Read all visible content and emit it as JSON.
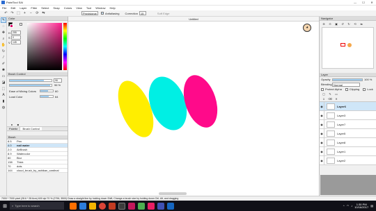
{
  "app": {
    "title": "PaintTool SAI"
  },
  "menu": [
    "File",
    "Edit",
    "Layer",
    "Filter",
    "Select",
    "Snap",
    "Colors",
    "View",
    "Tool",
    "Window",
    "Help"
  ],
  "toolbar": {
    "stabilizer_value": "Provisional",
    "antialiasing_label": "Antialiasing",
    "correction_label": "Correction",
    "correction_value": "15",
    "softedge_label": "Soft Edge"
  },
  "canvas": {
    "tab_title": "Untitled"
  },
  "color_panel": {
    "title": "Color",
    "h_value": "255",
    "s_value": "0",
    "v_value": "145"
  },
  "brush_control": {
    "title": "Brush Control",
    "size_value": "96",
    "density_value": "96 %",
    "min_size_label": "Ease of Mixing Colors",
    "min_size_value": "60",
    "load_color_label": "Load Color",
    "load_color_value": "64"
  },
  "tabs": {
    "palette": "Palette",
    "brush_control": "Brush Control"
  },
  "brush_panel": {
    "title": "Brush",
    "items": [
      {
        "size": "8.5",
        "name": "Pen"
      },
      {
        "size": "4.0",
        "name": "nail water"
      },
      {
        "size": "2.0",
        "name": "AirBrush"
      },
      {
        "size": "8.9",
        "name": "Watercolor"
      },
      {
        "size": "80",
        "name": "Blur"
      },
      {
        "size": "138",
        "name": "Thick"
      },
      {
        "size": "70",
        "name": "dots"
      },
      {
        "size": "144",
        "name": "cloud_brush_by_ashikan_cardinal"
      }
    ]
  },
  "navigator": {
    "title": "Navigator"
  },
  "layer_panel": {
    "title": "Layer",
    "opacity_label": "Opacity",
    "opacity_value": "100 %",
    "blending_label": "Blending",
    "blending_value": "Normal",
    "protect_alpha": "Protect Alpha",
    "clipping": "Clipping",
    "lock": "Lock",
    "layers": [
      "Layer6",
      "Layer3",
      "Layer7",
      "Layer5",
      "Layer8",
      "Layer1",
      "Layer2"
    ]
  },
  "statusbar": {
    "text": "7000 * 7000 pixel (28.6 * 28.6cm) 600 dpi 70 % (2796, 3500) Draw a straight line by holding down Shift, Change a brush size by holding down Ctrl, Alt, and dragging"
  },
  "taskbar": {
    "search_placeholder": "Type here to search",
    "time": "1:30 PM",
    "date": "10/16/2017"
  },
  "colors": {
    "yellow": "#ffee00",
    "cyan": "#00efe4",
    "magenta": "#ff0a8a",
    "selected_layer": "#cfe6f8",
    "taskbar": "#101018"
  }
}
